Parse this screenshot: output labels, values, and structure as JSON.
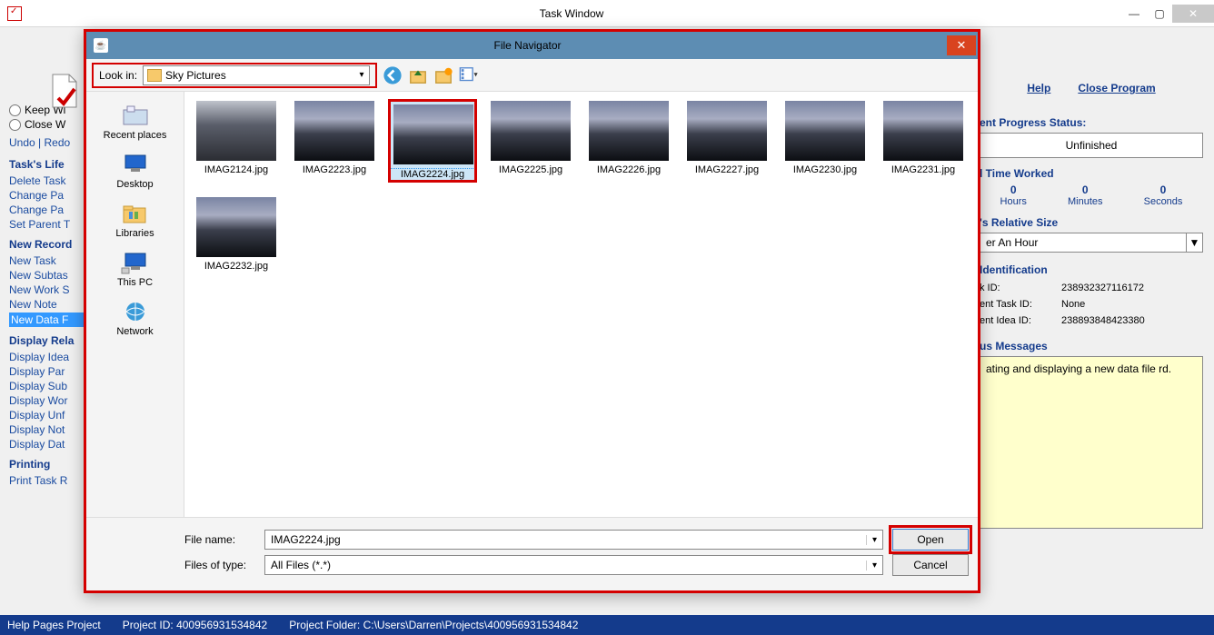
{
  "window": {
    "title": "Task Window",
    "minimize": "—",
    "maximize": "▢",
    "close": "✕"
  },
  "left": {
    "radio_keep": "Keep Wi",
    "radio_close": "Close W",
    "undo": "Undo",
    "redo": "Redo",
    "sections": {
      "life": {
        "head": "Task's Life",
        "items": [
          "Delete Task",
          "Change Pa",
          "Change Pa",
          "Set Parent T"
        ]
      },
      "newrec": {
        "head": "New Record",
        "items": [
          "New Task",
          "New Subtas",
          "New Work S",
          "New Note",
          "New Data F"
        ]
      },
      "display": {
        "head": "Display Rela",
        "items": [
          "Display Idea",
          "Display Par",
          "Display Sub",
          "Display Wor",
          "Display Unf",
          "Display Not",
          "Display Dat"
        ]
      },
      "print": {
        "head": "Printing",
        "items": [
          "Print Task R"
        ]
      }
    },
    "selected_item": "New Data F"
  },
  "right": {
    "help": "Help",
    "close_program": "Close Program",
    "progress_label": "ent Progress Status:",
    "progress_value": "Unfinished",
    "time_label": "l Time Worked",
    "time": {
      "hours_n": "0",
      "hours_l": "Hours",
      "mins_n": "0",
      "mins_l": "Minutes",
      "secs_n": "0",
      "secs_l": "Seconds"
    },
    "relsize_label": "'s Relative Size",
    "relsize_value": "er An Hour",
    "ident_label": " Identification",
    "ids": {
      "task_k": "k ID:",
      "task_v": "238932327116172",
      "parent_k": "ent Task ID:",
      "parent_v": "None",
      "idea_k": "ent Idea ID:",
      "idea_v": "238893848423380"
    },
    "status_label": "us Messages",
    "status_msg": "ating and displaying a new data file rd."
  },
  "statusbar": {
    "help_pages": "Help Pages Project",
    "project_id": "Project ID: 400956931534842",
    "project_folder": "Project Folder: C:\\Users\\Darren\\Projects\\400956931534842"
  },
  "dialog": {
    "title": "File Navigator",
    "close": "✕",
    "lookin_label": "Look in:",
    "lookin_value": "Sky Pictures",
    "places": [
      "Recent places",
      "Desktop",
      "Libraries",
      "This PC",
      "Network"
    ],
    "files": [
      "IMAG2124.jpg",
      "IMAG2223.jpg",
      "IMAG2224.jpg",
      "IMAG2225.jpg",
      "IMAG2226.jpg",
      "IMAG2227.jpg",
      "IMAG2230.jpg",
      "IMAG2231.jpg",
      "IMAG2232.jpg"
    ],
    "selected_file": "IMAG2224.jpg",
    "filename_label": "File name:",
    "filename_value": "IMAG2224.jpg",
    "filetype_label": "Files of type:",
    "filetype_value": "All Files (*.*)",
    "open": "Open",
    "cancel": "Cancel"
  }
}
